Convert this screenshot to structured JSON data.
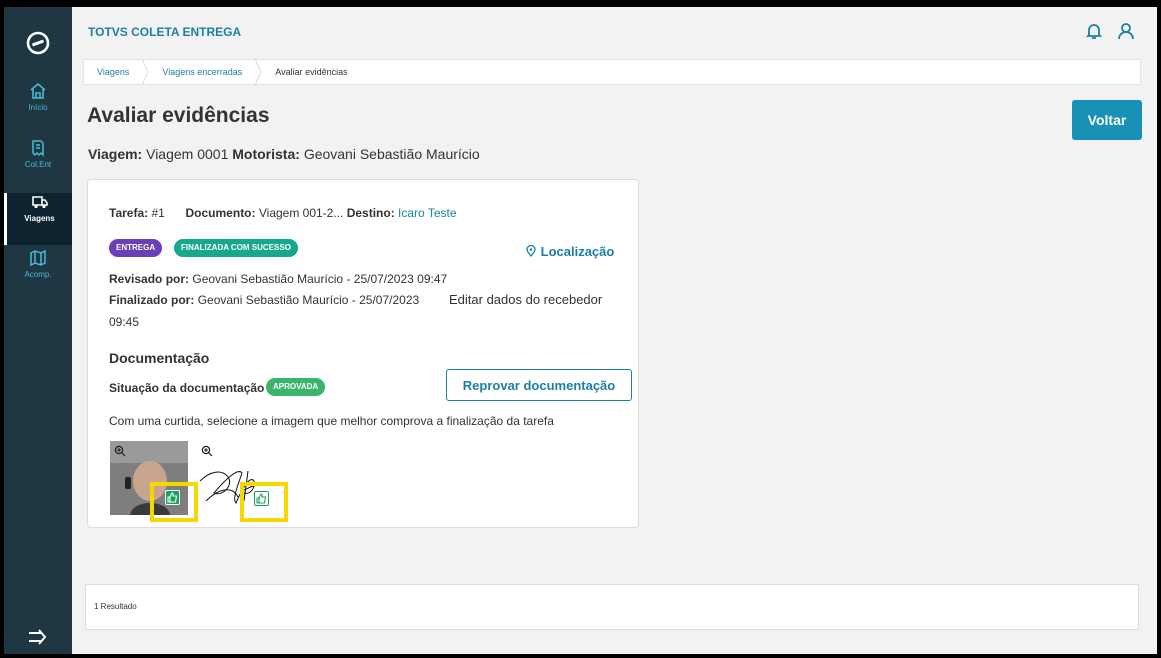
{
  "app": {
    "title": "TOTVS COLETA ENTREGA"
  },
  "sidebar": {
    "items": [
      {
        "label": "Início",
        "icon": "home-icon"
      },
      {
        "label": "Col.Ent",
        "icon": "receipt-icon"
      },
      {
        "label": "Viagens",
        "icon": "truck-icon",
        "active": true
      },
      {
        "label": "Acomp.",
        "icon": "map-icon"
      }
    ]
  },
  "breadcrumb": [
    "Viagens",
    "Viagens encerradas",
    "Avaliar evidências"
  ],
  "page": {
    "title": "Avaliar evidências",
    "back_label": "Voltar"
  },
  "trip": {
    "trip_label": "Viagem:",
    "trip_value": "Viagem 0001",
    "driver_label": "Motorista:",
    "driver_value": "Geovani Sebastião Maurício"
  },
  "task": {
    "task_label": "Tarefa:",
    "task_value": "#1",
    "document_label": "Documento:",
    "document_value": "Viagem 001-2...",
    "destination_label": "Destino:",
    "destination_value": "Icaro Teste",
    "tags": [
      "ENTREGA",
      "FINALIZADA COM SUCESSO"
    ],
    "location_label": "Localização",
    "reviewed_label": "Revisado por:",
    "reviewed_value": "Geovani Sebastião Maurício - 25/07/2023 09:47",
    "finished_label": "Finalizado por:",
    "finished_value": "Geovani Sebastião Maurício - 25/07/2023",
    "finished_time": "09:45",
    "edit_receiver_label": "Editar dados do recebedor",
    "doc_section_title": "Documentação",
    "doc_status_label": "Situação da documentação",
    "doc_status_badge": "APROVADA",
    "reject_label": "Reprovar documentação",
    "instruction": "Com uma curtida, selecione a imagem que melhor comprova a finalização da tarefa"
  },
  "footer": {
    "results": "1 Resultado"
  },
  "colors": {
    "accent": "#1791b6",
    "sidebar": "#1e3743",
    "highlight": "#f5d800",
    "approved": "#3bb56c"
  }
}
